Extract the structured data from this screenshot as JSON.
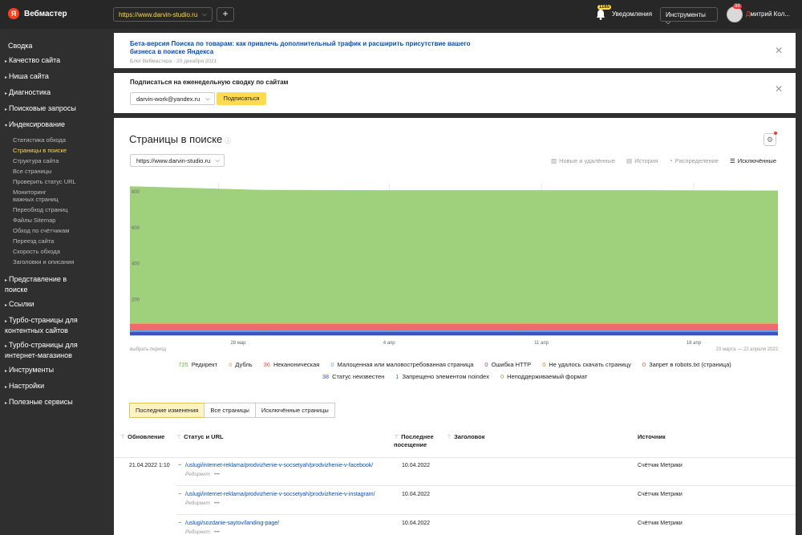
{
  "header": {
    "logo_letter": "Я",
    "app_title": "Вебмастер",
    "site": "https://www.darvin-studio.ru",
    "add_label": "+",
    "notif_count": "1165",
    "notif_label": "Уведомления",
    "tools_label": "Инструменты",
    "avatar_badge": "99",
    "user_first": "Д",
    "user_rest": "митрий Кол..."
  },
  "sidebar": {
    "items_top": [
      {
        "label": "Сводка"
      }
    ],
    "groups_before": [
      {
        "label": "Качество сайта"
      },
      {
        "label": "Ниша сайта"
      },
      {
        "label": "Диагностика"
      },
      {
        "label": "Поисковые запросы"
      },
      {
        "label": "Индексирование"
      }
    ],
    "sub_items": [
      {
        "label": "Статистика обхода"
      },
      {
        "label": "Страницы в поиске"
      },
      {
        "label": "Структура сайта"
      },
      {
        "label": "Все страницы"
      },
      {
        "label": "Проверить статус URL"
      },
      {
        "label": "Мониторинг важных страниц"
      },
      {
        "label": "Переобход страниц"
      },
      {
        "label": "Файлы Sitemap"
      },
      {
        "label": "Обход по счётчикам"
      },
      {
        "label": "Переезд сайта"
      },
      {
        "label": "Скорость обхода"
      },
      {
        "label": "Заголовки и описания"
      }
    ],
    "groups_after": [
      {
        "label": "Представление в поиске"
      },
      {
        "label": "Ссылки"
      },
      {
        "label": "Турбо-страницы для контентных сайтов"
      },
      {
        "label": "Турбо-страницы для интернет-магазинов"
      },
      {
        "label": "Инструменты"
      },
      {
        "label": "Настройки"
      },
      {
        "label": "Полезные сервисы"
      }
    ]
  },
  "banner1": {
    "title": "Бета-версия Поиска по товарам: как привлечь дополнительный трафик и расширить присутствие вашего бизнеса в поиске Яндекса",
    "meta": "Блог Вебмастера · 20 декабря 2021"
  },
  "banner2": {
    "title": "Подписаться на еженедельную сводку по сайтам",
    "email": "darvin-work@yandex.ru",
    "button": "Подписаться"
  },
  "panel": {
    "title": "Страницы в поиске",
    "site": "https://www.darvin-studio.ru",
    "views": [
      {
        "label": "Новые и удалённые",
        "icon": "bars-icon"
      },
      {
        "label": "История",
        "icon": "history-icon"
      },
      {
        "label": "Распределение",
        "icon": "pie-icon"
      },
      {
        "label": "Исключённые",
        "icon": "list-icon"
      }
    ],
    "period_label": "выбрать период",
    "date_range": "23 марта — 22 апреля 2022"
  },
  "chart_data": {
    "type": "area",
    "x": [
      "23 мар",
      "28 мар",
      "4 апр",
      "11 апр",
      "18 апр",
      "22 апр"
    ],
    "x_tick_labels": [
      "28 мар",
      "4 апр",
      "11 апр",
      "18 апр"
    ],
    "y_tick_labels": [
      "200",
      "400",
      "600",
      "800"
    ],
    "ylim": [
      0,
      850
    ],
    "series": [
      {
        "name": "Статус неизвестен",
        "color": "#3f51c7",
        "values": [
          20,
          20,
          20,
          20,
          20,
          20
        ]
      },
      {
        "name": "Малоценная или маловостребованная страница",
        "color": "#6fa8dc",
        "values": [
          8,
          8,
          8,
          8,
          8,
          8
        ]
      },
      {
        "name": "Неканоническая",
        "color": "#ef6a6a",
        "values": [
          36,
          36,
          36,
          36,
          36,
          36
        ]
      },
      {
        "name": "Дубль",
        "color": "#f4a64a",
        "values": [
          6,
          6,
          6,
          6,
          6,
          6
        ]
      },
      {
        "name": "Редирект",
        "color": "#9fd17c",
        "values": [
          760,
          740,
          738,
          738,
          738,
          736
        ]
      }
    ]
  },
  "legend_row1": [
    {
      "num": "725",
      "label": "Редирект",
      "color": "#6fb53a"
    },
    {
      "num": "6",
      "label": "Дубль",
      "color": "#f4a64a"
    },
    {
      "num": "36",
      "label": "Неканоническая",
      "color": "#e5533d"
    },
    {
      "num": "0",
      "label": "Малоценная или маловостребованная страница",
      "color": "#6fa8dc"
    },
    {
      "num": "0",
      "label": "Ошибка HTTP",
      "color": "#8e44ad"
    },
    {
      "num": "0",
      "label": "Не удалось скачать страницу",
      "color": "#e67e22"
    },
    {
      "num": "0",
      "label": "Запрет в robots.txt (страница)",
      "color": "#e74c3c"
    }
  ],
  "legend_row2": [
    {
      "num": "38",
      "label": "Статус неизвестен",
      "color": "#3f51c7"
    },
    {
      "num": "1",
      "label": "Запрещено элементом noindex",
      "color": "#2e8b57"
    },
    {
      "num": "0",
      "label": "Неподдерживаемый формат",
      "color": "#6fb53a"
    }
  ],
  "tabs": [
    {
      "label": "Последние изменения"
    },
    {
      "label": "Все страницы"
    },
    {
      "label": "Исключённые страницы"
    }
  ],
  "table": {
    "headers": {
      "updated": "Обновление",
      "status_url": "Статус и URL",
      "last_visit": "Последнее посещение",
      "heading": "Заголовок",
      "source": "Источник"
    },
    "date_group": "21.04.2022 1:10",
    "rows": [
      {
        "url": "/uslugi/internet-reklama/prodvizhenie-v-socsetyah/prodvizhenie-v-facebook/",
        "status": "Редирект",
        "more": "•••",
        "visit": "10.04.2022",
        "source": "Счётчик Метрики"
      },
      {
        "url": "/uslugi/internet-reklama/prodvizhenie-v-socsetyah/prodvizhenie-v-instagram/",
        "status": "Редирект",
        "more": "•••",
        "visit": "10.04.2022",
        "source": "Счётчик Метрики"
      },
      {
        "url": "/uslugi/sozdanie-saytov/landing-page/",
        "status": "Редирект",
        "more": "•••",
        "visit": "10.04.2022",
        "source": "Счётчик Метрики"
      }
    ]
  }
}
